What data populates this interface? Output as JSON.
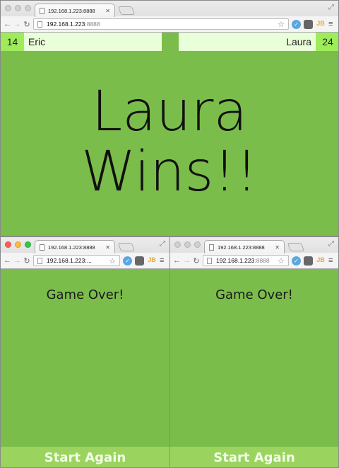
{
  "main_window": {
    "tab_title": "192.168.1.223:8888",
    "url_host": "192.168.1.223",
    "url_port": ":8888",
    "player_left": {
      "score": "14",
      "name": "Eric"
    },
    "player_right": {
      "score": "24",
      "name": "Laura"
    },
    "headline_line1": "Laura",
    "headline_line2": "Wins!!"
  },
  "left_window": {
    "tab_title": "192.168.1.223:8888",
    "url_text": "192.168.1.223:...",
    "message": "Game Over!",
    "button": "Start Again"
  },
  "right_window": {
    "tab_title": "192.168.1.223:8888",
    "url_host": "192.168.1.223",
    "url_port": ":8888",
    "message": "Game Over!",
    "button": "Start Again"
  },
  "colors": {
    "background_green": "#7bbd4b",
    "score_green": "#9eec5a",
    "name_bg": "#e9ffd9",
    "button_green": "#9ad45f"
  },
  "icons": [
    "back-icon",
    "forward-icon",
    "reload-icon",
    "bookmark-star-icon",
    "extension-icon",
    "pocket-icon",
    "jb-icon",
    "menu-icon",
    "fullscreen-icon"
  ]
}
